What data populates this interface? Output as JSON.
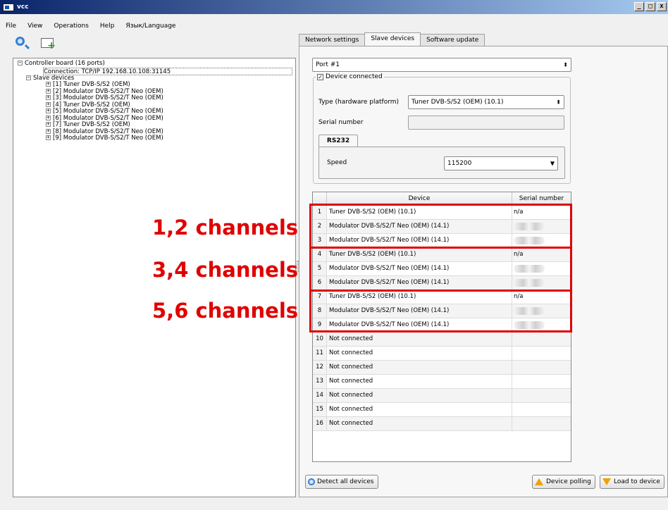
{
  "window": {
    "title": "vcc",
    "buttons": [
      "_",
      "□",
      "x"
    ]
  },
  "menu": [
    "File",
    "View",
    "Operations",
    "Help",
    "Язык/Language"
  ],
  "tree": {
    "root": "Controller board (16 ports)",
    "connection": "Connection: TCP/IP 192.168.10.108:31145",
    "slaves_label": "Slave devices",
    "items": [
      "[1] Tuner DVB-S/S2 (OEM)",
      "[2] Modulator DVB-S/S2/T Neo (OEM)",
      "[3] Modulator DVB-S/S2/T Neo (OEM)",
      "[4] Tuner DVB-S/S2 (OEM)",
      "[5] Modulator DVB-S/S2/T Neo (OEM)",
      "[6] Modulator DVB-S/S2/T Neo (OEM)",
      "[7] Tuner DVB-S/S2 (OEM)",
      "[8] Modulator DVB-S/S2/T Neo (OEM)",
      "[9] Modulator DVB-S/S2/T Neo (OEM)"
    ]
  },
  "tabs": [
    "Network settings",
    "Slave devices",
    "Software update"
  ],
  "slave": {
    "port": "Port #1",
    "device_connected": "Device connected",
    "type_label": "Type (hardware platform)",
    "type_value": "Tuner DVB-S/S2 (OEM) (10.1)",
    "serial_label": "Serial number",
    "rs_tab": "RS232",
    "speed_label": "Speed",
    "speed_value": "115200"
  },
  "table": {
    "headers": [
      "Device",
      "Serial number"
    ],
    "rows": [
      {
        "n": "1",
        "device": "Tuner DVB-S/S2 (OEM) (10.1)",
        "serial": "n/a"
      },
      {
        "n": "2",
        "device": "Modulator DVB-S/S2/T Neo (OEM) (14.1)",
        "serial": ""
      },
      {
        "n": "3",
        "device": "Modulator DVB-S/S2/T Neo (OEM) (14.1)",
        "serial": ""
      },
      {
        "n": "4",
        "device": "Tuner DVB-S/S2 (OEM) (10.1)",
        "serial": "n/a"
      },
      {
        "n": "5",
        "device": "Modulator DVB-S/S2/T Neo (OEM) (14.1)",
        "serial": ""
      },
      {
        "n": "6",
        "device": "Modulator DVB-S/S2/T Neo (OEM) (14.1)",
        "serial": ""
      },
      {
        "n": "7",
        "device": "Tuner DVB-S/S2 (OEM) (10.1)",
        "serial": "n/a"
      },
      {
        "n": "8",
        "device": "Modulator DVB-S/S2/T Neo (OEM) (14.1)",
        "serial": ""
      },
      {
        "n": "9",
        "device": "Modulator DVB-S/S2/T Neo (OEM) (14.1)",
        "serial": ""
      },
      {
        "n": "10",
        "device": "Not connected",
        "serial": ""
      },
      {
        "n": "11",
        "device": "Not connected",
        "serial": ""
      },
      {
        "n": "12",
        "device": "Not connected",
        "serial": ""
      },
      {
        "n": "13",
        "device": "Not connected",
        "serial": ""
      },
      {
        "n": "14",
        "device": "Not connected",
        "serial": ""
      },
      {
        "n": "15",
        "device": "Not connected",
        "serial": ""
      },
      {
        "n": "16",
        "device": "Not connected",
        "serial": ""
      }
    ]
  },
  "annotations": [
    "1,2 channels",
    "3,4 channels",
    "5,6 channels"
  ],
  "buttons": {
    "detect": "Detect all devices",
    "polling": "Device polling",
    "load": "Load to device"
  },
  "colors": {
    "annotation": "#e00000",
    "titlebar": "#0a246a"
  }
}
